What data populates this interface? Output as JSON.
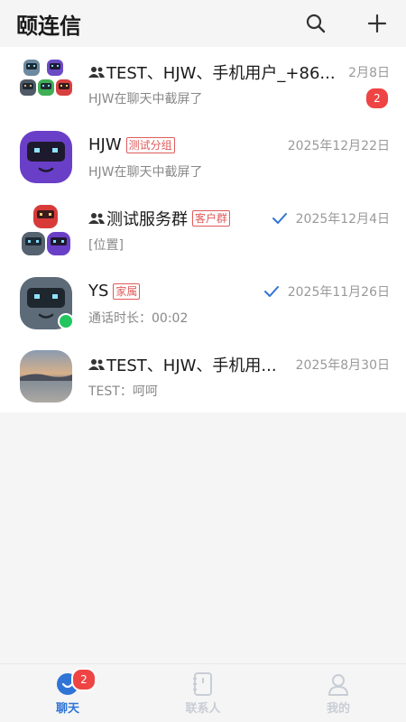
{
  "header": {
    "title": "颐连信"
  },
  "conversations": [
    {
      "name": "TEST、HJW、手机用户_+86...",
      "preview": "HJW在聊天中截屏了",
      "date": "2月8日",
      "unread": "2",
      "is_group": true
    },
    {
      "name": "HJW",
      "tag": "测试分组",
      "preview": "HJW在聊天中截屏了",
      "date": "2025年12月22日"
    },
    {
      "name": "测试服务群",
      "tag": "客户群",
      "preview": "[位置]",
      "date": "2025年12月4日",
      "sent": true,
      "is_group": true
    },
    {
      "name": "YS",
      "tag": "家属",
      "preview": "通话时长：00:02",
      "date": "2025年11月26日",
      "sent": true,
      "online": true
    },
    {
      "name": "TEST、HJW、手机用...",
      "preview": "TEST：呵呵",
      "date": "2025年8月30日",
      "is_group": true
    }
  ],
  "tabbar": {
    "tabs": [
      {
        "label": "聊天",
        "badge": "2",
        "active": true
      },
      {
        "label": "联系人"
      },
      {
        "label": "我的"
      }
    ]
  },
  "colors": {
    "accent": "#2f74d6",
    "badge": "#ef4444",
    "tag": "#e05a5a",
    "online": "#22c55e"
  }
}
